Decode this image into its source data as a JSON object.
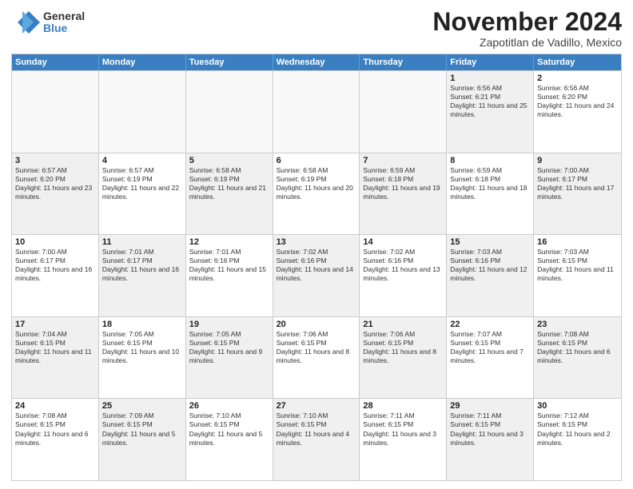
{
  "logo": {
    "general": "General",
    "blue": "Blue"
  },
  "title": "November 2024",
  "location": "Zapotitlan de Vadillo, Mexico",
  "header_days": [
    "Sunday",
    "Monday",
    "Tuesday",
    "Wednesday",
    "Thursday",
    "Friday",
    "Saturday"
  ],
  "rows": [
    [
      {
        "day": "",
        "text": "",
        "empty": true
      },
      {
        "day": "",
        "text": "",
        "empty": true
      },
      {
        "day": "",
        "text": "",
        "empty": true
      },
      {
        "day": "",
        "text": "",
        "empty": true
      },
      {
        "day": "",
        "text": "",
        "empty": true
      },
      {
        "day": "1",
        "text": "Sunrise: 6:56 AM\nSunset: 6:21 PM\nDaylight: 11 hours and 25 minutes.",
        "shaded": true
      },
      {
        "day": "2",
        "text": "Sunrise: 6:56 AM\nSunset: 6:20 PM\nDaylight: 11 hours and 24 minutes.",
        "shaded": false
      }
    ],
    [
      {
        "day": "3",
        "text": "Sunrise: 6:57 AM\nSunset: 6:20 PM\nDaylight: 11 hours and 23 minutes.",
        "shaded": true
      },
      {
        "day": "4",
        "text": "Sunrise: 6:57 AM\nSunset: 6:19 PM\nDaylight: 11 hours and 22 minutes.",
        "shaded": false
      },
      {
        "day": "5",
        "text": "Sunrise: 6:58 AM\nSunset: 6:19 PM\nDaylight: 11 hours and 21 minutes.",
        "shaded": true
      },
      {
        "day": "6",
        "text": "Sunrise: 6:58 AM\nSunset: 6:19 PM\nDaylight: 11 hours and 20 minutes.",
        "shaded": false
      },
      {
        "day": "7",
        "text": "Sunrise: 6:59 AM\nSunset: 6:18 PM\nDaylight: 11 hours and 19 minutes.",
        "shaded": true
      },
      {
        "day": "8",
        "text": "Sunrise: 6:59 AM\nSunset: 6:18 PM\nDaylight: 11 hours and 18 minutes.",
        "shaded": false
      },
      {
        "day": "9",
        "text": "Sunrise: 7:00 AM\nSunset: 6:17 PM\nDaylight: 11 hours and 17 minutes.",
        "shaded": true
      }
    ],
    [
      {
        "day": "10",
        "text": "Sunrise: 7:00 AM\nSunset: 6:17 PM\nDaylight: 11 hours and 16 minutes.",
        "shaded": false
      },
      {
        "day": "11",
        "text": "Sunrise: 7:01 AM\nSunset: 6:17 PM\nDaylight: 11 hours and 16 minutes.",
        "shaded": true
      },
      {
        "day": "12",
        "text": "Sunrise: 7:01 AM\nSunset: 6:16 PM\nDaylight: 11 hours and 15 minutes.",
        "shaded": false
      },
      {
        "day": "13",
        "text": "Sunrise: 7:02 AM\nSunset: 6:16 PM\nDaylight: 11 hours and 14 minutes.",
        "shaded": true
      },
      {
        "day": "14",
        "text": "Sunrise: 7:02 AM\nSunset: 6:16 PM\nDaylight: 11 hours and 13 minutes.",
        "shaded": false
      },
      {
        "day": "15",
        "text": "Sunrise: 7:03 AM\nSunset: 6:16 PM\nDaylight: 11 hours and 12 minutes.",
        "shaded": true
      },
      {
        "day": "16",
        "text": "Sunrise: 7:03 AM\nSunset: 6:15 PM\nDaylight: 11 hours and 11 minutes.",
        "shaded": false
      }
    ],
    [
      {
        "day": "17",
        "text": "Sunrise: 7:04 AM\nSunset: 6:15 PM\nDaylight: 11 hours and 11 minutes.",
        "shaded": true
      },
      {
        "day": "18",
        "text": "Sunrise: 7:05 AM\nSunset: 6:15 PM\nDaylight: 11 hours and 10 minutes.",
        "shaded": false
      },
      {
        "day": "19",
        "text": "Sunrise: 7:05 AM\nSunset: 6:15 PM\nDaylight: 11 hours and 9 minutes.",
        "shaded": true
      },
      {
        "day": "20",
        "text": "Sunrise: 7:06 AM\nSunset: 6:15 PM\nDaylight: 11 hours and 8 minutes.",
        "shaded": false
      },
      {
        "day": "21",
        "text": "Sunrise: 7:06 AM\nSunset: 6:15 PM\nDaylight: 11 hours and 8 minutes.",
        "shaded": true
      },
      {
        "day": "22",
        "text": "Sunrise: 7:07 AM\nSunset: 6:15 PM\nDaylight: 11 hours and 7 minutes.",
        "shaded": false
      },
      {
        "day": "23",
        "text": "Sunrise: 7:08 AM\nSunset: 6:15 PM\nDaylight: 11 hours and 6 minutes.",
        "shaded": true
      }
    ],
    [
      {
        "day": "24",
        "text": "Sunrise: 7:08 AM\nSunset: 6:15 PM\nDaylight: 11 hours and 6 minutes.",
        "shaded": false
      },
      {
        "day": "25",
        "text": "Sunrise: 7:09 AM\nSunset: 6:15 PM\nDaylight: 11 hours and 5 minutes.",
        "shaded": true
      },
      {
        "day": "26",
        "text": "Sunrise: 7:10 AM\nSunset: 6:15 PM\nDaylight: 11 hours and 5 minutes.",
        "shaded": false
      },
      {
        "day": "27",
        "text": "Sunrise: 7:10 AM\nSunset: 6:15 PM\nDaylight: 11 hours and 4 minutes.",
        "shaded": true
      },
      {
        "day": "28",
        "text": "Sunrise: 7:11 AM\nSunset: 6:15 PM\nDaylight: 11 hours and 3 minutes.",
        "shaded": false
      },
      {
        "day": "29",
        "text": "Sunrise: 7:11 AM\nSunset: 6:15 PM\nDaylight: 11 hours and 3 minutes.",
        "shaded": true
      },
      {
        "day": "30",
        "text": "Sunrise: 7:12 AM\nSunset: 6:15 PM\nDaylight: 11 hours and 2 minutes.",
        "shaded": false
      }
    ]
  ]
}
